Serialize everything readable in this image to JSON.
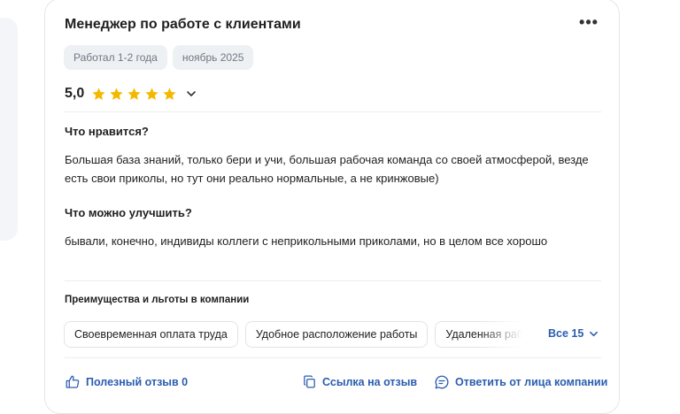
{
  "review": {
    "title": "Менеджер по работе с клиентами",
    "chips": [
      "Работал 1-2 года",
      "ноябрь 2025"
    ],
    "rating": "5,0",
    "stars": 5,
    "pros_label": "Что нравится?",
    "pros_text": "Большая база знаний, только бери и учи, большая рабочая команда со своей атмосферой, везде есть свои приколы, но тут они реально нормальные, а не кринжовые)",
    "cons_label": "Что можно улучшить?",
    "cons_text": "бывали, конечно, индивиды коллеги с неприкольными приколами, но в целом все хорошо",
    "perks_title": "Преимущества и льготы в компании",
    "perks": [
      "Своевременная оплата труда",
      "Удобное расположение работы",
      "Удаленная работа"
    ],
    "all_perks": "Все 15",
    "helpful": "Полезный отзыв 0",
    "link": "Ссылка на отзыв",
    "reply": "Ответить от лица компании"
  },
  "colors": {
    "accent": "#2a5db0",
    "star": "#f5b800",
    "chip_bg": "#eef1f4"
  },
  "icons": [
    "more-icon",
    "star-icon",
    "chevron-down-icon",
    "thumbs-up-icon",
    "copy-link-icon",
    "chat-reply-icon"
  ]
}
